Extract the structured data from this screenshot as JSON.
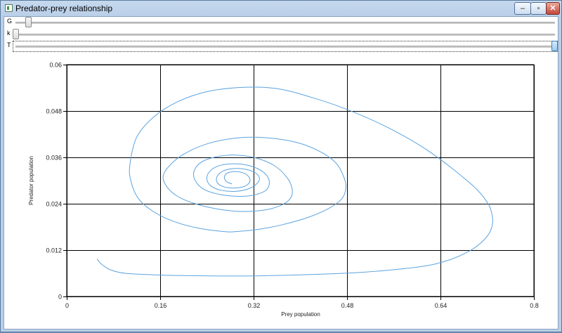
{
  "window": {
    "title": "Predator-prey relationship",
    "controls": {
      "minimize": "–",
      "maximize": "▫",
      "close": "✕"
    }
  },
  "sliders": [
    {
      "label": "G",
      "position": 0.024
    },
    {
      "label": "k",
      "position": 0.0
    },
    {
      "label": "T",
      "position": 1.0
    }
  ],
  "chart_data": {
    "type": "line",
    "title": "",
    "xlabel": "Prey population",
    "ylabel": "Predator population",
    "xlim": [
      0,
      0.8
    ],
    "ylim": [
      0,
      0.06
    ],
    "xticks": [
      "0",
      "0.16",
      "0.32",
      "0.48",
      "0.64",
      "0.8"
    ],
    "yticks": [
      "0",
      "0.012",
      "0.024",
      "0.036",
      "0.048",
      "0.06"
    ],
    "grid": true,
    "series": [
      {
        "color": "#5ba3e0",
        "x": [
          0.052,
          0.06,
          0.075,
          0.1,
          0.15,
          0.2,
          0.3,
          0.4,
          0.5,
          0.6,
          0.65,
          0.69,
          0.715,
          0.727,
          0.729,
          0.72,
          0.69,
          0.62,
          0.55,
          0.48,
          0.42,
          0.36,
          0.3,
          0.24,
          0.19,
          0.15,
          0.12,
          0.108,
          0.11,
          0.122,
          0.145,
          0.18,
          0.225,
          0.27,
          0.29,
          0.33,
          0.37,
          0.41,
          0.445,
          0.47,
          0.478,
          0.474,
          0.46,
          0.43,
          0.39,
          0.34,
          0.29,
          0.24,
          0.2,
          0.175,
          0.165,
          0.172,
          0.19,
          0.22,
          0.26,
          0.3,
          0.34,
          0.37,
          0.385,
          0.385,
          0.375,
          0.355,
          0.325,
          0.29,
          0.255,
          0.23,
          0.218,
          0.22,
          0.235,
          0.262,
          0.295,
          0.322,
          0.342,
          0.347,
          0.342,
          0.328,
          0.305,
          0.28,
          0.258,
          0.244,
          0.24,
          0.247,
          0.264,
          0.288,
          0.31,
          0.325,
          0.33,
          0.323,
          0.307,
          0.286,
          0.268,
          0.258,
          0.257,
          0.265,
          0.281,
          0.3,
          0.312,
          0.313,
          0.305,
          0.29,
          0.276,
          0.27,
          0.273,
          0.283
        ],
        "y": [
          0.0097,
          0.0083,
          0.0069,
          0.006,
          0.0056,
          0.0054,
          0.0053,
          0.0056,
          0.0062,
          0.0076,
          0.0092,
          0.0118,
          0.0147,
          0.0175,
          0.0205,
          0.0244,
          0.0294,
          0.0376,
          0.0437,
          0.0484,
          0.0515,
          0.0538,
          0.0541,
          0.053,
          0.0504,
          0.0466,
          0.0413,
          0.034,
          0.0298,
          0.0255,
          0.0223,
          0.0196,
          0.0177,
          0.0168,
          0.0168,
          0.0174,
          0.0186,
          0.0203,
          0.0225,
          0.0251,
          0.028,
          0.0311,
          0.0347,
          0.0378,
          0.04,
          0.0411,
          0.041,
          0.0395,
          0.0368,
          0.0337,
          0.031,
          0.0283,
          0.0259,
          0.024,
          0.0226,
          0.022,
          0.0224,
          0.0238,
          0.0259,
          0.0285,
          0.0312,
          0.0339,
          0.0358,
          0.0366,
          0.0361,
          0.0347,
          0.0324,
          0.03,
          0.0277,
          0.0264,
          0.0259,
          0.0263,
          0.0276,
          0.0296,
          0.0314,
          0.033,
          0.0341,
          0.0343,
          0.0337,
          0.0322,
          0.0303,
          0.0286,
          0.0275,
          0.0272,
          0.0278,
          0.0291,
          0.0306,
          0.032,
          0.0329,
          0.0331,
          0.0325,
          0.0312,
          0.0297,
          0.0286,
          0.0281,
          0.0283,
          0.0293,
          0.0306,
          0.0318,
          0.0323,
          0.032,
          0.031,
          0.0298,
          0.0291
        ]
      }
    ]
  }
}
